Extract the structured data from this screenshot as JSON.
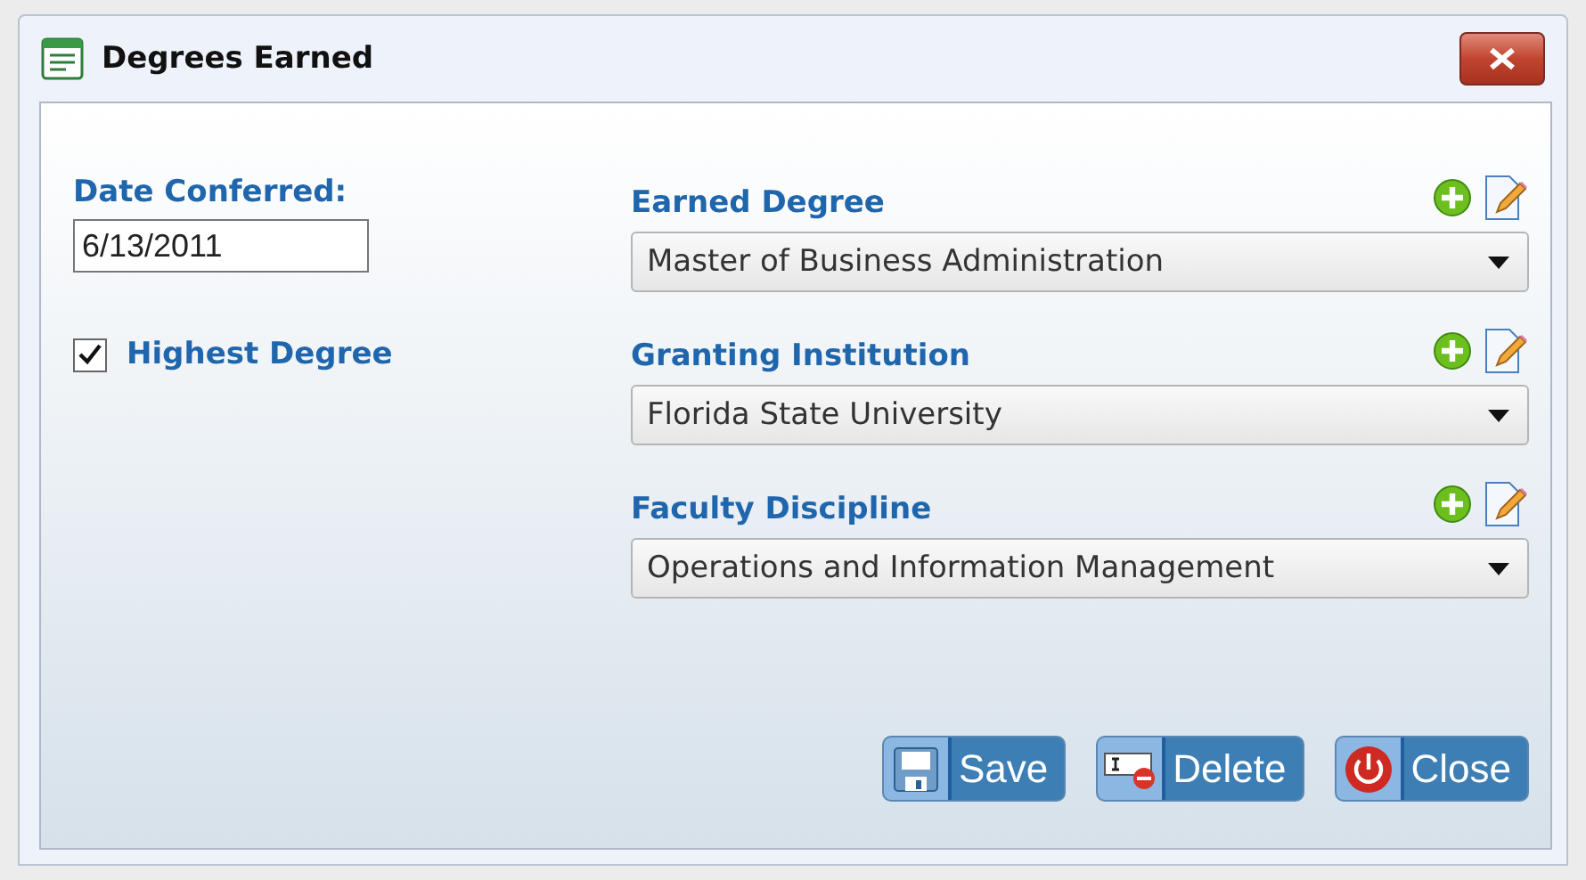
{
  "window": {
    "title": "Degrees Earned"
  },
  "date_field": {
    "label": "Date Conferred:",
    "value": "6/13/2011"
  },
  "highest_degree": {
    "label": "Highest Degree",
    "checked": true
  },
  "dropdowns": [
    {
      "label": "Earned Degree",
      "value": "Master of Business Administration"
    },
    {
      "label": "Granting Institution",
      "value": "Florida State University"
    },
    {
      "label": "Faculty Discipline",
      "value": "Operations and Information Management"
    }
  ],
  "buttons": [
    {
      "label": "Save",
      "kind": "save"
    },
    {
      "label": "Delete",
      "kind": "delete"
    },
    {
      "label": "Close",
      "kind": "close"
    }
  ]
}
